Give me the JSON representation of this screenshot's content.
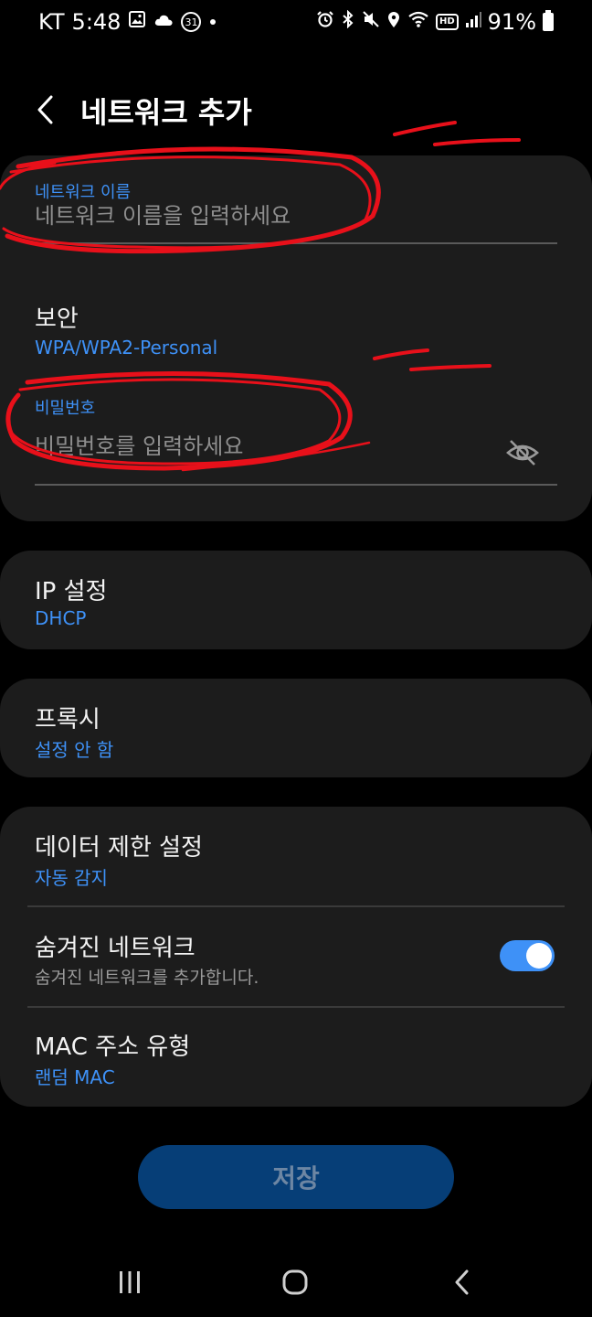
{
  "status_bar": {
    "carrier": "KT",
    "time": "5:48",
    "calendar_day": "31",
    "hd_label": "HD",
    "battery": "91%",
    "left_icons": [
      "gallery-icon",
      "cloud-icon",
      "calendar-icon",
      "dot-icon"
    ],
    "right_icons": [
      "alarm-icon",
      "bluetooth-icon",
      "mute-icon",
      "location-icon",
      "wifi-icon",
      "hd-voice-icon",
      "signal-icon",
      "battery-icon"
    ]
  },
  "header": {
    "title": "네트워크 추가",
    "back_icon": "chevron-left-icon"
  },
  "network_card": {
    "name_label": "네트워크 이름",
    "name_placeholder": "네트워크 이름을 입력하세요",
    "name_value": "",
    "security_title": "보안",
    "security_value": "WPA/WPA2-Personal",
    "password_label": "비밀번호",
    "password_placeholder": "비밀번호를 입력하세요",
    "password_value": "",
    "password_visibility_icon": "eye-off-icon"
  },
  "ip_card": {
    "title": "IP 설정",
    "value": "DHCP"
  },
  "proxy_card": {
    "title": "프록시",
    "value": "설정 안 함"
  },
  "advanced_card": {
    "metered_title": "데이터 제한 설정",
    "metered_value": "자동 감지",
    "hidden_title": "숨겨진 네트워크",
    "hidden_desc": "숨겨진 네트워크를 추가합니다.",
    "hidden_toggle_on": true,
    "mac_title": "MAC 주소 유형",
    "mac_value": "랜덤 MAC"
  },
  "save_button": {
    "label": "저장",
    "enabled": false
  },
  "nav_bar": {
    "icons": [
      "recents-icon",
      "home-icon",
      "back-icon"
    ]
  },
  "colors": {
    "background": "#000000",
    "card": "#1c1c1c",
    "accent": "#3e91f7",
    "save_button_disabled": "#063e77",
    "annotation": "#e8101a"
  }
}
